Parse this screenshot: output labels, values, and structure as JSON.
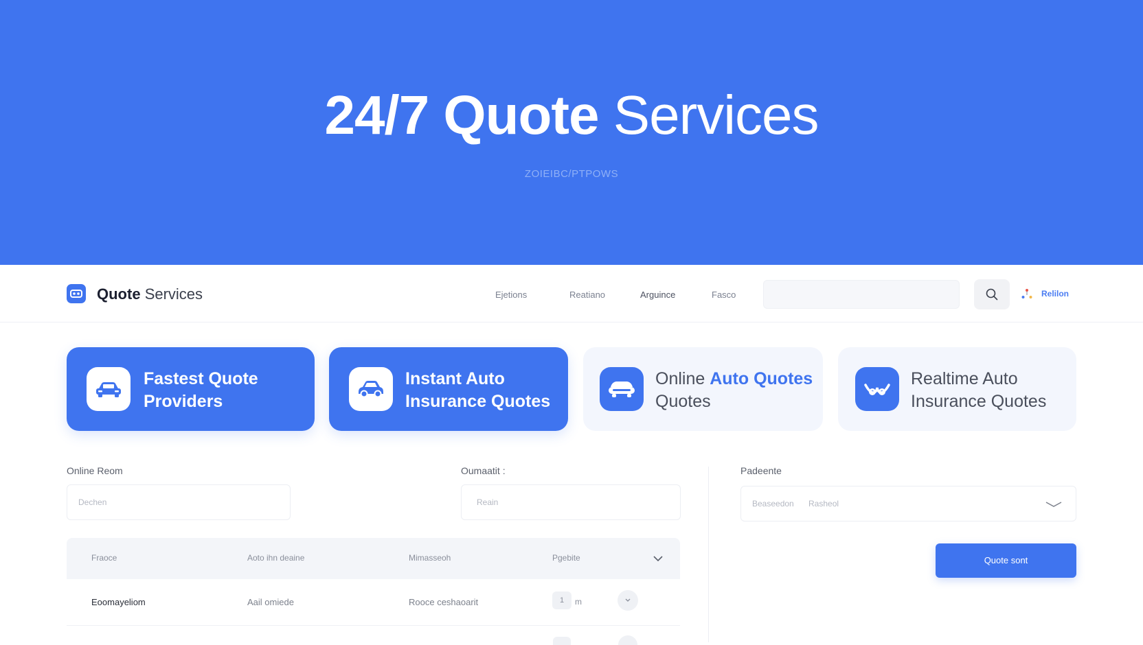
{
  "hero": {
    "title_bold": "24/7 Quote",
    "title_light": "Services",
    "subtitle": "ZOIEIBC/PTPOWS"
  },
  "header": {
    "brand_bold": "Quote",
    "brand_light": "Services",
    "nav": [
      "Ejetions",
      "Reatiano",
      "Arguince",
      "Fasco"
    ],
    "search_placeholder": "",
    "account_label": "Relilon"
  },
  "cards": [
    {
      "line1": "Fastest Quote",
      "line2": "Providers",
      "icon": "car-icon"
    },
    {
      "line1": "Instant Auto",
      "line2": "Insurance Quotes",
      "icon": "car-icon"
    },
    {
      "line1_plain": "Online ",
      "line1_highlight": "Auto Quotes",
      "line2": "Quotes",
      "icon": "car-front-icon"
    },
    {
      "line1": "Realtime Auto",
      "line2": "Insurance Quotes",
      "icon": "handshake-icon"
    }
  ],
  "form": {
    "field1": {
      "label": "Online Reom",
      "placeholder": "Dechen"
    },
    "field2": {
      "label": "Oumaatit :",
      "placeholder": "Reain"
    },
    "field3": {
      "label": "Padeente",
      "placeholder_a": "Beaseedon",
      "placeholder_b": "Rasheol"
    },
    "submit_label": "Quote sont"
  },
  "table": {
    "headers": [
      "Fraoce",
      "Aoto ihn deaine",
      "Mimasseoh",
      "Pgebite"
    ],
    "rows": [
      {
        "name": "Eoomayeliom",
        "type": "Aail omiede",
        "detail": "Rooce ceshaoarit",
        "qty": "1",
        "unit": "m"
      }
    ]
  },
  "colors": {
    "accent": "#3f74ef",
    "hero_bg": "#3f74ef",
    "card_light": "#f3f6fd"
  }
}
